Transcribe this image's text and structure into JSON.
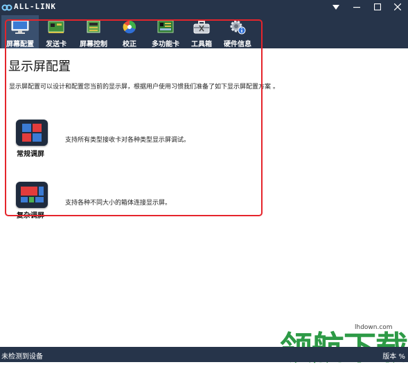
{
  "window": {
    "title": "ALL-LINK",
    "controls": [
      "dropdown-icon",
      "minimize-icon",
      "maximize-icon",
      "close-icon"
    ]
  },
  "toolbar": {
    "items": [
      {
        "label": "屏幕配置",
        "icon": "monitor-icon",
        "active": true
      },
      {
        "label": "发送卡",
        "icon": "sender-card-icon",
        "active": false
      },
      {
        "label": "屏幕控制",
        "icon": "screen-control-icon",
        "active": false
      },
      {
        "label": "校正",
        "icon": "calibration-icon",
        "active": false
      },
      {
        "label": "多功能卡",
        "icon": "multifunction-card-icon",
        "active": false
      },
      {
        "label": "工具箱",
        "icon": "toolbox-icon",
        "active": false
      },
      {
        "label": "硬件信息",
        "icon": "hardware-info-icon",
        "active": false
      }
    ]
  },
  "main": {
    "title": "显示屏配置",
    "description": "显示屏配置可以设计和配置您当前的显示屏，根据用户使用习惯我们准备了如下显示屏配置方案 。",
    "options": [
      {
        "label": "常规调屏",
        "description": "支持所有类型接收卡对各种类型显示屏调试。",
        "icon": "regular-config-icon"
      },
      {
        "label": "复杂调屏",
        "description": "支持各种不同大小的箱体连接显示屏。",
        "icon": "complex-config-icon"
      }
    ]
  },
  "status": {
    "left": "未检测到设备",
    "right": "版本 %"
  },
  "watermark": {
    "text": "领航下载",
    "url": "lhdown.com"
  },
  "colors": {
    "chrome": "#26344a",
    "active_tab": "#3a506f",
    "highlight_frame": "#e5242b",
    "watermark_green": "#2d9a46"
  }
}
